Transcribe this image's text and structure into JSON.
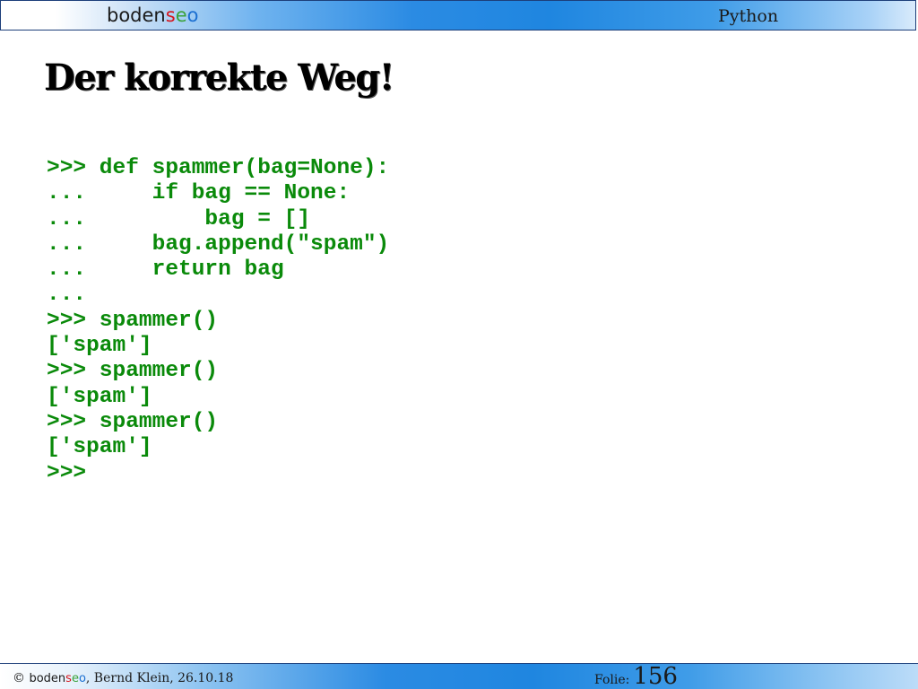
{
  "header": {
    "logo": {
      "part1": "boden",
      "part2": "s",
      "part3": "e",
      "part4": "o"
    },
    "title": "Python"
  },
  "slide": {
    "title": "Der korrekte Weg!"
  },
  "code": {
    "lines": [
      ">>> def spammer(bag=None):",
      "...     if bag == None:",
      "...         bag = []",
      "...     bag.append(\"spam\")",
      "...     return bag",
      "...",
      ">>> spammer()",
      "['spam']",
      ">>> spammer()",
      "['spam']",
      ">>> spammer()",
      "['spam']",
      ">>>"
    ]
  },
  "footer": {
    "copyright_symbol": "© ",
    "logo": {
      "part1": "boden",
      "part2": "s",
      "part3": "e",
      "part4": "o"
    },
    "author_date": ", Bernd Klein, 26.10.18",
    "folie_label": "Folie:",
    "slide_number": "156"
  },
  "colors": {
    "code_green": "#0a8a0a",
    "logo_red": "#d6141b",
    "logo_green": "#3aa23a",
    "logo_blue": "#1b6fd1",
    "bar_blue": "#1f86e0"
  }
}
